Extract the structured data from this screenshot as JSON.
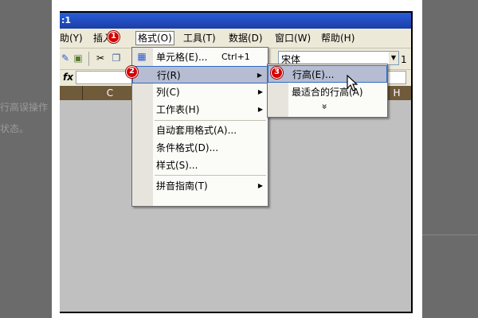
{
  "background": {
    "text1": "行高误操作",
    "text2": "状态。"
  },
  "window": {
    "title": ":1"
  },
  "menubar": {
    "items": [
      {
        "label": "助(Y)"
      },
      {
        "label": "插入"
      },
      {
        "label": "格式(O)"
      },
      {
        "label": "工具(T)"
      },
      {
        "label": "数据(D)"
      },
      {
        "label": "窗口(W)"
      },
      {
        "label": "帮助(H)"
      }
    ]
  },
  "toolbar": {
    "font_name": "宋体",
    "font_size": "1"
  },
  "formula_bar": {
    "fx_label": "fx"
  },
  "columns": [
    "C",
    "H"
  ],
  "format_menu": {
    "items": [
      {
        "label": "单元格(E)...",
        "shortcut": "Ctrl+1"
      },
      {
        "label": "行(R)"
      },
      {
        "label": "列(C)"
      },
      {
        "label": "工作表(H)"
      },
      {
        "label": "自动套用格式(A)..."
      },
      {
        "label": "条件格式(D)..."
      },
      {
        "label": "样式(S)..."
      },
      {
        "label": "拼音指南(T)"
      }
    ]
  },
  "row_submenu": {
    "items": [
      {
        "label": "行高(E)..."
      },
      {
        "label": "最适合的行高(A)"
      }
    ],
    "expand": "»"
  },
  "badges": [
    "1",
    "2",
    "3"
  ],
  "colors": {
    "highlight": "#b6bdd2",
    "badge": "#d60000",
    "column_header": "#6f5a3a",
    "title_bar": "#2a5cd8"
  }
}
